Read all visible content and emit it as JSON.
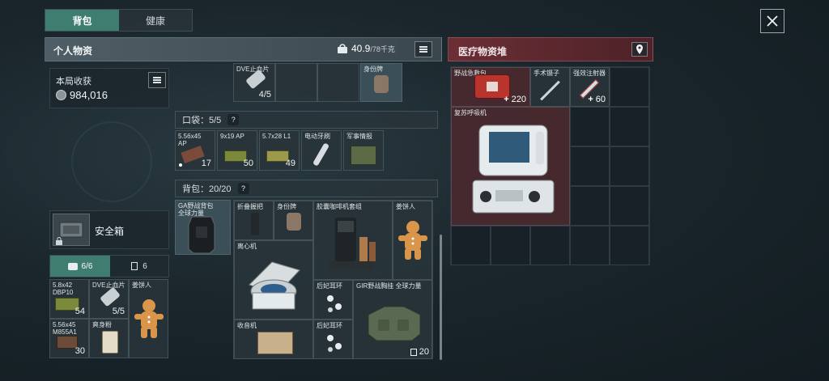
{
  "tabs": [
    {
      "label": "背包",
      "active": true
    },
    {
      "label": "健康",
      "active": false
    }
  ],
  "personal": {
    "title": "个人物资",
    "weight_value": "40.9",
    "weight_max": "/78千克"
  },
  "earnings": {
    "label": "本局收获",
    "value": "984,016"
  },
  "top_partial": [
    {
      "label": "DVE止血片",
      "count": "4/5"
    },
    {
      "label": "",
      "count": ""
    },
    {
      "label": "",
      "count": ""
    },
    {
      "label": "身份牌",
      "count": ""
    }
  ],
  "pocket": {
    "label": "口袋：5/5",
    "help": "?",
    "items": [
      {
        "label": "5.56x45 AP",
        "count": "17"
      },
      {
        "label": "9x19 AP",
        "count": "50"
      },
      {
        "label": "5.7x28 L1",
        "count": "49"
      },
      {
        "label": "电动牙刷",
        "count": ""
      },
      {
        "label": "军事情报",
        "count": ""
      }
    ]
  },
  "backpack": {
    "label": "背包：20/20",
    "help": "?",
    "equipped": "GA野战背包 全球力量",
    "items": [
      {
        "label": "折叠握把"
      },
      {
        "label": "身份牌"
      },
      {
        "label": "胶囊咖啡机套组"
      },
      {
        "label": "姜饼人"
      },
      {
        "label": "离心机"
      },
      {
        "label": "后妃耳环"
      },
      {
        "label": "GIR野战胸挂 全球力量"
      },
      {
        "label": "收音机"
      },
      {
        "label": "后妃耳环"
      }
    ],
    "capacity_count": "20"
  },
  "safebox": {
    "label": "安全箱"
  },
  "safebox_tabs": [
    {
      "label": "6/6",
      "active": true
    },
    {
      "label": "6",
      "active": false
    }
  ],
  "safebox_items": [
    {
      "label": "5.8x42 DBP10",
      "count": "54"
    },
    {
      "label": "DVE止血片",
      "count": "5/5"
    },
    {
      "label": "姜饼人",
      "count": ""
    },
    {
      "label": "5.56x45 M855A1",
      "count": "30"
    },
    {
      "label": "爽身粉",
      "count": ""
    }
  ],
  "medical": {
    "title": "医疗物资堆",
    "items": [
      {
        "label": "野战急救包",
        "count": "220"
      },
      {
        "label": "手术镊子",
        "count": ""
      },
      {
        "label": "强效注射器",
        "count": "60"
      },
      {
        "label": "复苏呼吸机",
        "count": ""
      }
    ]
  },
  "icons": [
    "close-icon",
    "weight-icon",
    "list-icon",
    "location-pin-icon",
    "backpack-icon",
    "lock-icon",
    "coin-icon"
  ]
}
